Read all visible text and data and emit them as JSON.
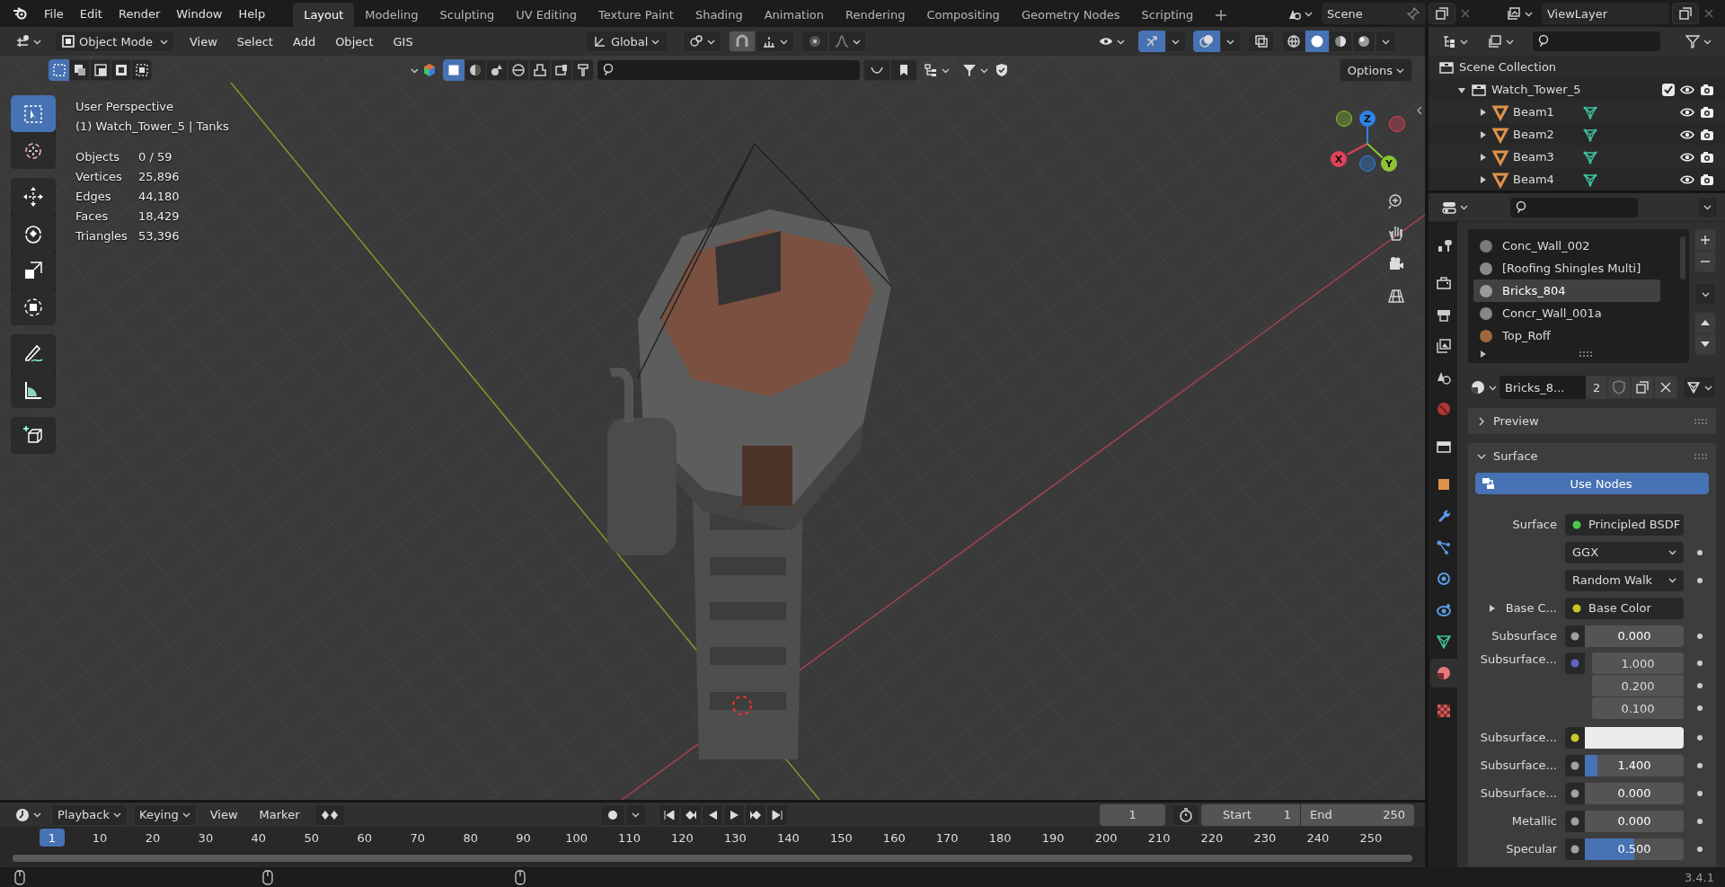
{
  "menu": [
    "File",
    "Edit",
    "Render",
    "Window",
    "Help"
  ],
  "workspaces": [
    {
      "label": "Layout",
      "selected": true
    },
    {
      "label": "Modeling",
      "selected": false
    },
    {
      "label": "Sculpting",
      "selected": false
    },
    {
      "label": "UV Editing",
      "selected": false
    },
    {
      "label": "Texture Paint",
      "selected": false
    },
    {
      "label": "Shading",
      "selected": false
    },
    {
      "label": "Animation",
      "selected": false
    },
    {
      "label": "Rendering",
      "selected": false
    },
    {
      "label": "Compositing",
      "selected": false
    },
    {
      "label": "Geometry Nodes",
      "selected": false
    },
    {
      "label": "Scripting",
      "selected": false
    }
  ],
  "scene": {
    "name": "Scene"
  },
  "view_layer": {
    "name": "ViewLayer"
  },
  "viewport": {
    "mode": "Object Mode",
    "menus": [
      "View",
      "Select",
      "Add",
      "Object",
      "GIS"
    ],
    "orientation": "Global",
    "gizmos_on": true,
    "overlays_on": true,
    "shading": [
      {
        "selected": false
      },
      {
        "selected": true
      },
      {
        "selected": false
      },
      {
        "selected": false
      }
    ],
    "select_modes": [
      {
        "selected": true
      },
      {
        "selected": false
      },
      {
        "selected": false
      },
      {
        "selected": false
      },
      {
        "selected": false
      }
    ],
    "filters": [
      {
        "selected": true
      },
      {
        "selected": false
      },
      {
        "selected": false
      },
      {
        "selected": false
      },
      {
        "selected": false
      },
      {
        "selected": false
      },
      {
        "selected": false
      }
    ],
    "options": "Options",
    "info": [
      "User Perspective",
      "(1) Watch_Tower_5 | Tanks"
    ],
    "stats": [
      {
        "label": "Objects",
        "value": "0 / 59"
      },
      {
        "label": "Vertices",
        "value": "25,896"
      },
      {
        "label": "Edges",
        "value": "44,180"
      },
      {
        "label": "Faces",
        "value": "18,429"
      },
      {
        "label": "Triangles",
        "value": "53,396"
      }
    ],
    "tools": [
      {
        "kind": "select",
        "selected": true
      },
      {
        "kind": "cursor",
        "selected": false
      },
      {
        "kind": "move",
        "selected": false
      },
      {
        "kind": "rotate",
        "selected": false
      },
      {
        "kind": "scale",
        "selected": false
      },
      {
        "kind": "transform",
        "selected": false
      },
      {
        "kind": "annotate",
        "selected": false
      },
      {
        "kind": "measure",
        "selected": false
      },
      {
        "kind": "add_cube",
        "selected": false
      }
    ],
    "axes": [
      {
        "label": "Z",
        "color": "#2f83e3"
      },
      {
        "label": "X",
        "color": "#e2405b"
      },
      {
        "label": "Y",
        "color": "#8ac531"
      }
    ]
  },
  "outliner": {
    "root": "Scene Collection",
    "collections": [
      {
        "name": "Watch_Tower_5",
        "expanded": true,
        "checked": true,
        "children": [
          {
            "name": "Beam1",
            "expanded": false
          },
          {
            "name": "Beam2",
            "expanded": false
          },
          {
            "name": "Beam3",
            "expanded": false
          },
          {
            "name": "Beam4",
            "expanded": false
          }
        ]
      }
    ]
  },
  "properties": {
    "tabs": [
      {
        "kind": "tool",
        "selected": false
      },
      {
        "kind": "render",
        "selected": false
      },
      {
        "kind": "output",
        "selected": false
      },
      {
        "kind": "view_layer",
        "selected": false
      },
      {
        "kind": "scene",
        "selected": false
      },
      {
        "kind": "world",
        "selected": false
      },
      {
        "kind": "collection",
        "selected": false
      },
      {
        "kind": "object",
        "selected": false
      },
      {
        "kind": "modifiers",
        "selected": false
      },
      {
        "kind": "particles",
        "selected": false
      },
      {
        "kind": "physics",
        "selected": false
      },
      {
        "kind": "constraints",
        "selected": false
      },
      {
        "kind": "data",
        "selected": false
      },
      {
        "kind": "material",
        "selected": true
      },
      {
        "kind": "texture",
        "selected": false
      }
    ],
    "materials": [
      {
        "name": "Conc_Wall_002",
        "selected": false,
        "color": "#7a7a7a"
      },
      {
        "name": "[Roofing Shingles Multi]",
        "selected": false,
        "color": "#8a8a8a"
      },
      {
        "name": "Bricks_804",
        "selected": true,
        "color": "#9a9a9a"
      },
      {
        "name": "Concr_Wall_001a",
        "selected": false,
        "color": "#888888"
      },
      {
        "name": "Top_Roff",
        "selected": false,
        "color": "#a0683c"
      }
    ],
    "material_name": "Bricks_8...",
    "users": "2",
    "panels": [
      {
        "label": "Preview",
        "expanded": false
      },
      {
        "label": "Surface",
        "expanded": true
      }
    ],
    "use_nodes": "Use Nodes",
    "fields": [
      {
        "kind": "link",
        "label": "Surface",
        "value": "Principled BSDF",
        "color": "#4ec94e"
      },
      {
        "kind": "dropdown",
        "value": "GGX"
      },
      {
        "kind": "dropdown",
        "value": "Random Walk"
      },
      {
        "kind": "link",
        "label": "Base C...",
        "value": "Base Color",
        "color": "#c7c729",
        "expanded": false
      },
      {
        "kind": "number",
        "label": "Subsurface",
        "value": "0.000",
        "color": "#a1a1a1"
      },
      {
        "kind": "vector",
        "label": "Subsurface...",
        "color": "#6363c7",
        "values": [
          "1.000",
          "0.200",
          "0.100"
        ]
      },
      {
        "kind": "color",
        "label": "Subsurface...",
        "color": "#ebebeb"
      },
      {
        "kind": "number",
        "label": "Subsurface...",
        "value": "1.400",
        "color": "#a1a1a1",
        "level": 0.13
      },
      {
        "kind": "number",
        "label": "Subsurface...",
        "value": "0.000",
        "color": "#a1a1a1"
      },
      {
        "kind": "number",
        "label": "Metallic",
        "value": "0.000",
        "color": "#a1a1a1"
      },
      {
        "kind": "number",
        "label": "Specular",
        "value": "0.500",
        "color": "#a1a1a1",
        "level": 0.5
      }
    ]
  },
  "timeline": {
    "menus": [
      "Playback",
      "Keying",
      "View",
      "Marker"
    ],
    "current_frame": "1",
    "start_label": "Start",
    "start": "1",
    "end_label": "End",
    "end": "250",
    "playhead": "1",
    "ticks": [
      "10",
      "20",
      "30",
      "40",
      "50",
      "60",
      "70",
      "80",
      "90",
      "100",
      "110",
      "120",
      "130",
      "140",
      "150",
      "160",
      "170",
      "180",
      "190",
      "200",
      "210",
      "220",
      "230",
      "240",
      "250"
    ]
  },
  "status": {
    "version": "3.4.1"
  }
}
